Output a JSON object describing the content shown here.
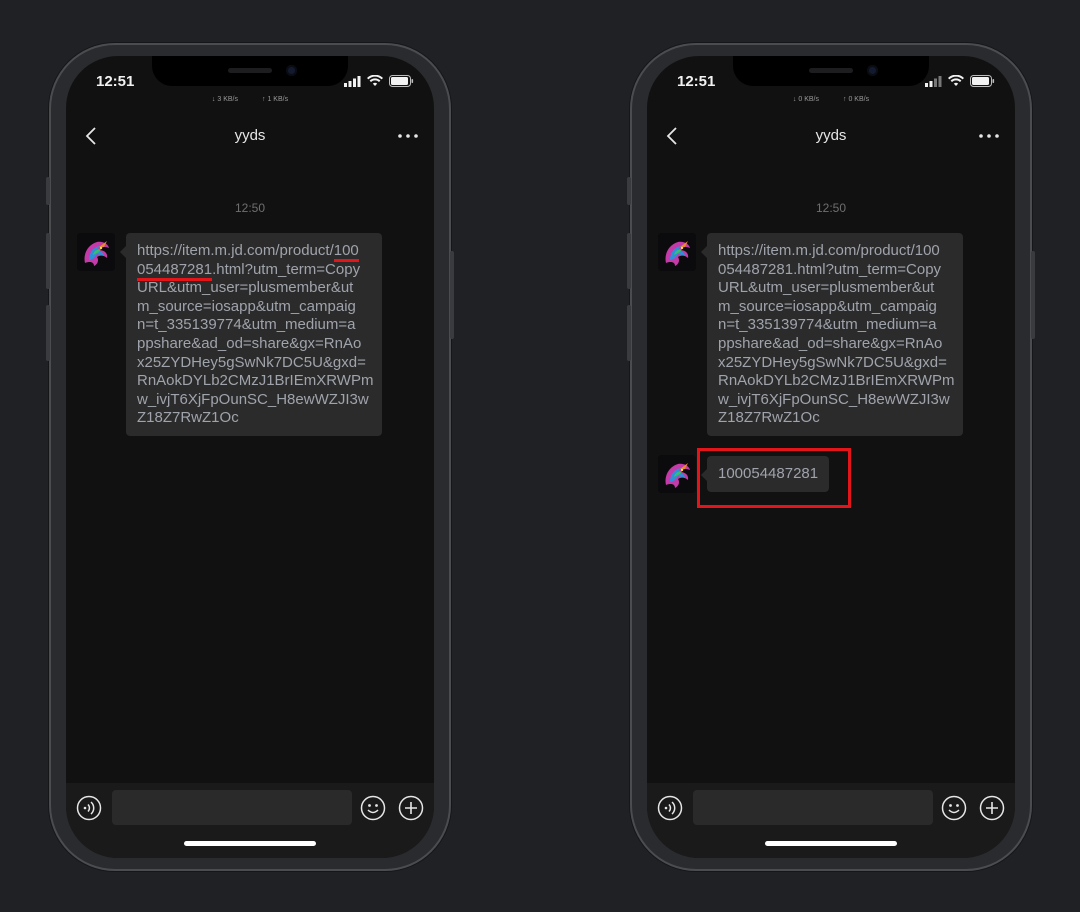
{
  "phones": [
    {
      "status": {
        "time": "12:51",
        "down_speed": "↓ 3 KB/s",
        "up_speed": "↑ 1 KB/s"
      },
      "nav": {
        "title": "yyds"
      },
      "timestamp": "12:50",
      "message_lines": [
        "https://item.m.jd.com/product/100",
        "054487281.html?utm_term=Copy",
        "URL&utm_user=plusmember&ut",
        "m_source=iosapp&utm_campaig",
        "n=t_335139774&utm_medium=a",
        "ppshare&ad_od=share&gx=RnAo",
        "x25ZYDHey5gSwNk7DC5U&gxd=",
        "RnAokDYLb2CMzJ1BrIEmXRWPm",
        "w_ivjT6XjFpOunSC_H8ewWZJI3w",
        "Z18Z7RwZ1Oc"
      ],
      "highlight": {
        "line1_prefix": "https://item.m.jd.com/product/",
        "line1_id": "100",
        "line2_id": "054487281",
        "line2_rest": ".html?utm_term=Copy"
      }
    },
    {
      "status": {
        "time": "12:51",
        "down_speed": "↓ 0 KB/s",
        "up_speed": "↑ 0 KB/s"
      },
      "nav": {
        "title": "yyds"
      },
      "timestamp": "12:50",
      "message_lines": [
        "https://item.m.jd.com/product/100",
        "054487281.html?utm_term=Copy",
        "URL&utm_user=plusmember&ut",
        "m_source=iosapp&utm_campaig",
        "n=t_335139774&utm_medium=a",
        "ppshare&ad_od=share&gx=RnAo",
        "x25ZYDHey5gSwNk7DC5U&gxd=",
        "RnAokDYLb2CMzJ1BrIEmXRWPm",
        "w_ivjT6XjFpOunSC_H8ewWZJI3w",
        "Z18Z7RwZ1Oc"
      ],
      "reply": "100054487281"
    }
  ],
  "colors": {
    "highlight": "#e1151a",
    "bubble": "#2b2b2b",
    "bubble_text": "#9fa3ab"
  },
  "icons": [
    "back-chevron-icon",
    "more-dots-icon",
    "voice-icon",
    "emoji-icon",
    "plus-icon",
    "signal-icon",
    "wifi-icon",
    "battery-icon"
  ]
}
